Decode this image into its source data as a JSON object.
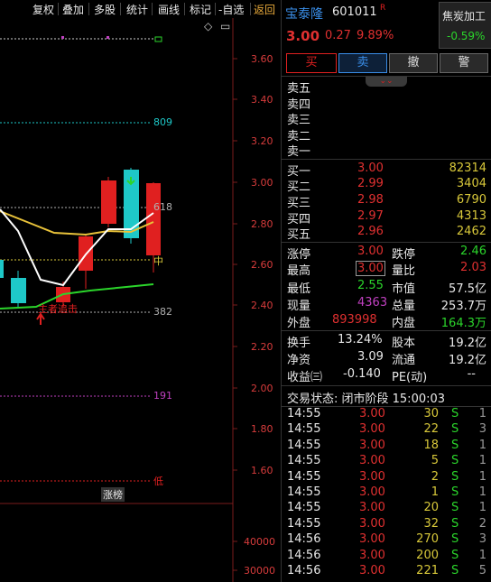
{
  "toolbar": {
    "items": [
      "复权",
      "叠加",
      "多股",
      "统计",
      "画线",
      "标记",
      "-自选",
      "返回"
    ],
    "active_color": "#e8a93a"
  },
  "chart": {
    "price_axis": [
      "3.60",
      "3.40",
      "3.20",
      "3.00",
      "2.80",
      "2.60",
      "2.40",
      "2.20",
      "2.00",
      "1.80",
      "1.60"
    ],
    "volume_axis": [
      "40000",
      "30000"
    ],
    "fib_labels": {
      "l809": "809",
      "l618": "618",
      "l382": "382",
      "l191": "191"
    },
    "mid_label": "中",
    "low_label": "低",
    "annotation": "主者追击",
    "limit_tag": "涨榜",
    "diamond_icon": "◇",
    "colors": {
      "up": "#e02020",
      "down": "#1ec8c8",
      "ma_white": "#ffffff",
      "ma_yellow": "#e8c23a",
      "ma_green": "#2bd52b",
      "axis_red": "#d83c3c"
    }
  },
  "stock": {
    "name": "宝泰隆",
    "code": "601011",
    "flag": "R",
    "price": "3.00",
    "change": "0.27",
    "pct": "9.89%",
    "sector": "焦炭加工",
    "sector_pct": "-0.59%"
  },
  "actions": {
    "buy": "买",
    "sell": "卖",
    "cancel": "撤",
    "alert": "警"
  },
  "sell_book": [
    "卖五",
    "卖四",
    "卖三",
    "卖二",
    "卖一"
  ],
  "buy_book": [
    {
      "label": "买一",
      "price": "3.00",
      "vol": "82314"
    },
    {
      "label": "买二",
      "price": "2.99",
      "vol": "3404"
    },
    {
      "label": "买三",
      "price": "2.98",
      "vol": "6790"
    },
    {
      "label": "买四",
      "price": "2.97",
      "vol": "4313"
    },
    {
      "label": "买五",
      "price": "2.96",
      "vol": "2462"
    }
  ],
  "stats": {
    "limit_up_label": "涨停",
    "limit_up": "3.00",
    "limit_down_label": "跌停",
    "limit_down": "2.46",
    "high_label": "最高",
    "high": "3.00",
    "vol_ratio_label": "量比",
    "vol_ratio": "2.03",
    "low_label": "最低",
    "low": "2.55",
    "mktcap_label": "市值",
    "mktcap": "57.5亿",
    "cur_vol_label": "现量",
    "cur_vol": "4363",
    "total_vol_label": "总量",
    "total_vol": "253.7万",
    "outer_label": "外盘",
    "outer": "893998",
    "inner_label": "内盘",
    "inner": "164.3万",
    "turnover_label": "换手",
    "turnover": "13.24%",
    "shares_label": "股本",
    "shares": "19.2亿",
    "nav_label": "净资",
    "nav": "3.09",
    "float_label": "流通",
    "float": "19.2亿",
    "eps_label": "收益㈢",
    "eps": "-0.140",
    "pe_label": "PE(动)",
    "pe": "--"
  },
  "trade_status": "交易状态: 闭市阶段 15:00:03",
  "ticks": [
    {
      "time": "14:55",
      "price": "3.00",
      "vol": "30",
      "side": "S",
      "n": "1"
    },
    {
      "time": "14:55",
      "price": "3.00",
      "vol": "22",
      "side": "S",
      "n": "3"
    },
    {
      "time": "14:55",
      "price": "3.00",
      "vol": "18",
      "side": "S",
      "n": "1"
    },
    {
      "time": "14:55",
      "price": "3.00",
      "vol": "5",
      "side": "S",
      "n": "1"
    },
    {
      "time": "14:55",
      "price": "3.00",
      "vol": "2",
      "side": "S",
      "n": "1"
    },
    {
      "time": "14:55",
      "price": "3.00",
      "vol": "1",
      "side": "S",
      "n": "1"
    },
    {
      "time": "14:55",
      "price": "3.00",
      "vol": "20",
      "side": "S",
      "n": "1"
    },
    {
      "time": "14:55",
      "price": "3.00",
      "vol": "32",
      "side": "S",
      "n": "2"
    },
    {
      "time": "14:56",
      "price": "3.00",
      "vol": "270",
      "side": "S",
      "n": "3"
    },
    {
      "time": "14:56",
      "price": "3.00",
      "vol": "200",
      "side": "S",
      "n": "1"
    },
    {
      "time": "14:56",
      "price": "3.00",
      "vol": "221",
      "side": "S",
      "n": "5"
    }
  ]
}
